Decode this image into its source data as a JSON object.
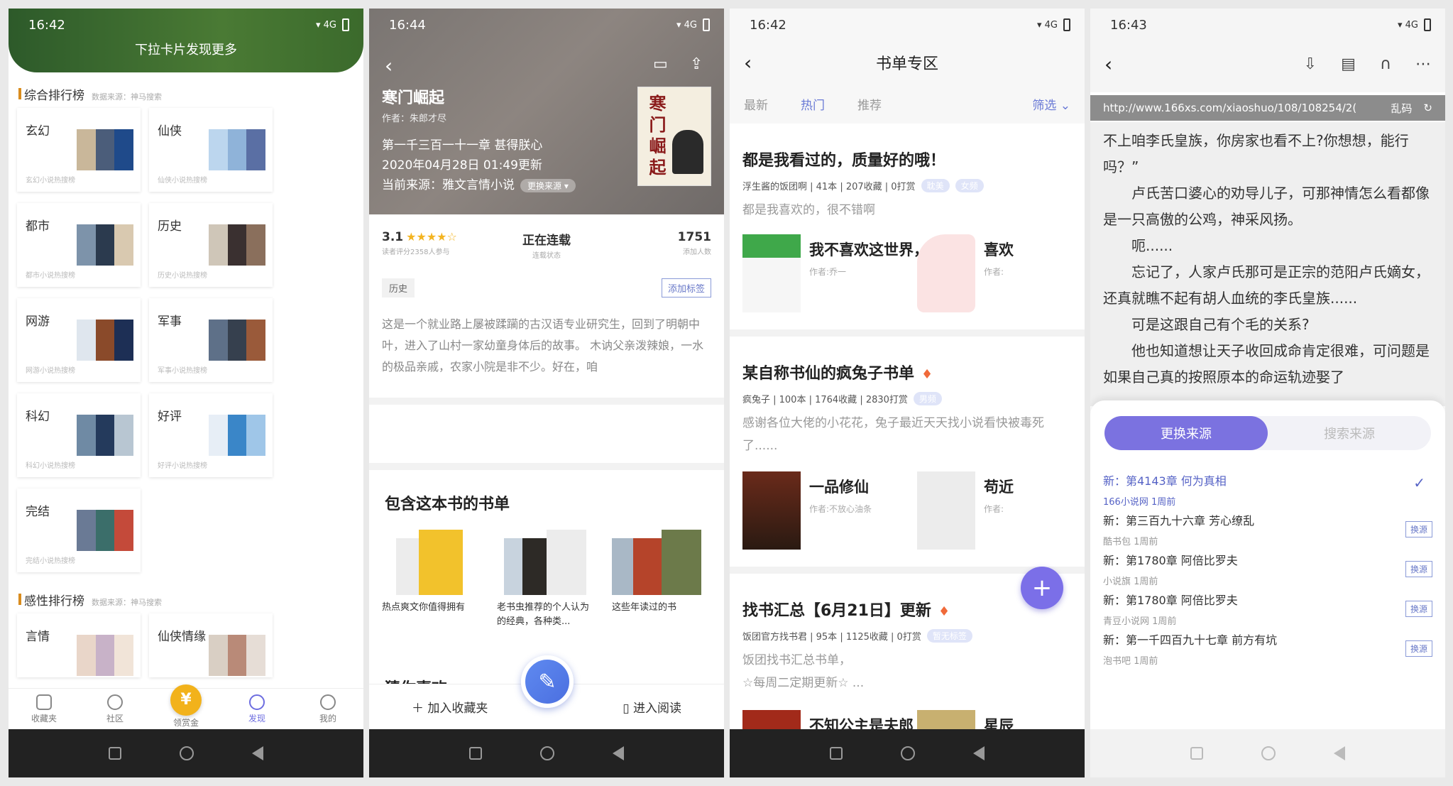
{
  "panel1": {
    "time": "16:42",
    "pull_hint": "下拉卡片发现更多",
    "section1": {
      "title": "综合排行榜",
      "source": "数据来源：神马搜索"
    },
    "cards": [
      {
        "name": "玄幻",
        "sub": "玄幻小说热搜榜"
      },
      {
        "name": "仙侠",
        "sub": "仙侠小说热搜榜"
      },
      {
        "name": "都市",
        "sub": "都市小说热搜榜"
      },
      {
        "name": "历史",
        "sub": "历史小说热搜榜"
      },
      {
        "name": "网游",
        "sub": "网游小说热搜榜"
      },
      {
        "name": "军事",
        "sub": "军事小说热搜榜"
      },
      {
        "name": "科幻",
        "sub": "科幻小说热搜榜"
      },
      {
        "name": "好评",
        "sub": "好评小说热搜榜"
      },
      {
        "name": "完结",
        "sub": "完结小说热搜榜"
      }
    ],
    "section2": {
      "title": "感性排行榜",
      "source": "数据来源：神马搜索"
    },
    "cards2": [
      {
        "name": "言情"
      },
      {
        "name": "仙侠情缘"
      }
    ],
    "tabs": [
      "收藏夹",
      "社区",
      "领赏金",
      "发现",
      "我的"
    ],
    "coin": "¥"
  },
  "panel2": {
    "time": "16:44",
    "title": "寒门崛起",
    "author": "作者：朱郎才尽",
    "latest": "第一千三百一十一章 甚得朕心",
    "updated": "2020年04月28日 01:49更新",
    "source": "当前来源：雅文言情小说",
    "change_source": "更换来源 ▾",
    "cover_title": "寒门崛起",
    "rating": "3.1",
    "stars": "★★★★☆",
    "rating_sub": "读者评分2358人参与",
    "status": "正在连载",
    "status_sub": "连载状态",
    "joined": "1751",
    "joined_sub": "添加人数",
    "tag": "历史",
    "add_tag": "添加标签",
    "desc": "这是一个就业路上屡被蹂躏的古汉语专业研究生，回到了明朝中叶，进入了山村一家幼童身体后的故事。 木讷父亲泼辣娘，一水的极品亲戚，农家小院是非不少。好在，咱",
    "lists_title": "包含这本书的书单",
    "lists": [
      {
        "label": "热点爽文你值得拥有"
      },
      {
        "label": "老书虫推荐的个人认为的经典，各种类..."
      },
      {
        "label": "这些年读过的书"
      }
    ],
    "guess": "猜你喜欢",
    "add_fav": "加入收藏夹",
    "read": "进入阅读"
  },
  "panel3": {
    "time": "16:42",
    "title": "书单专区",
    "tabs": [
      "最新",
      "热门",
      "推荐"
    ],
    "filter": "筛选 ⌄",
    "lists": [
      {
        "title": "都是我看过的，质量好的哦！",
        "meta": "浮生酱的饭团啊 | 41本 | 207收藏 | 0打赏",
        "tags": [
          "耽美",
          "女频"
        ],
        "desc": "都是我喜欢的，很不错啊",
        "book1": {
          "name": "我不喜欢这世界，...",
          "author": "作者:乔一"
        },
        "book2": {
          "name": "喜欢",
          "author": "作者:"
        }
      },
      {
        "title": "某自称书仙的疯兔子书单",
        "meta": "疯兔子 | 100本 | 1764收藏 | 2830打赏",
        "tags": [
          "男频"
        ],
        "desc": "感谢各位大佬的小花花，兔子最近天天找小说看快被毒死了......",
        "book1": {
          "name": "一品修仙",
          "author": "作者:不放心油条"
        },
        "book2": {
          "name": "苟近",
          "author": "作者:"
        }
      },
      {
        "title": "找书汇总【6月21日】更新",
        "meta": "饭团官方找书君 | 95本 | 1125收藏 | 0打赏",
        "tags": [
          "暂无标签"
        ],
        "desc": "饭团找书汇总书单，\n☆每周二定期更新☆ ...",
        "book1": {
          "name": "不知公主是夫郎",
          "author": ""
        },
        "book2": {
          "name": "星辰",
          "author": ""
        }
      }
    ],
    "fab": "+"
  },
  "panel4": {
    "time": "16:43",
    "url": "http://www.166xs.com/xiaoshuo/108/108254/2(",
    "garbled": "乱码",
    "paragraphs": [
      "不上咱李氏皇族，你房家也看不上?你想想，能行吗？”",
      "卢氏苦口婆心的劝导儿子，可那神情怎么看都像是一只高傲的公鸡，神采风扬。",
      "呃......",
      "忘记了，人家卢氏那可是正宗的范阳卢氏嫡女，还真就瞧不起有胡人血统的李氏皇族......",
      "可是这跟自己有个毛的关系?",
      "他也知道想让天子收回成命肯定很难，可问题是如果自己真的按照原本的命运轨迹娶了"
    ],
    "seg_change": "更换来源",
    "seg_search": "搜索来源",
    "sources": [
      {
        "chapter": "新：第4143章 何为真相",
        "site": "166小说网  1周前",
        "current": true
      },
      {
        "chapter": "新：第三百九十六章 芳心缭乱",
        "site": "酷书包  1周前",
        "swap": "换源"
      },
      {
        "chapter": "新：第1780章 阿倍比罗夫",
        "site": "小说旗  1周前",
        "swap": "换源"
      },
      {
        "chapter": "新：第1780章 阿倍比罗夫",
        "site": "青豆小说网  1周前",
        "swap": "换源"
      },
      {
        "chapter": "新：第一千四百九十七章 前方有坑",
        "site": "泡书吧  1周前",
        "swap": "换源"
      }
    ]
  }
}
